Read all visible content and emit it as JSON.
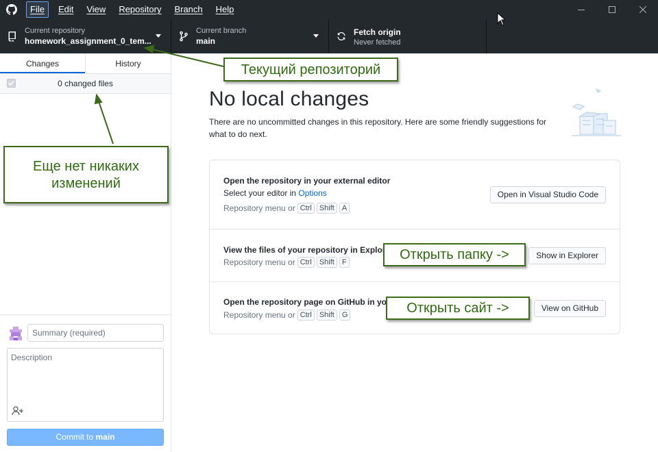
{
  "menu": {
    "items": [
      "File",
      "Edit",
      "View",
      "Repository",
      "Branch",
      "Help"
    ],
    "active_index": 0
  },
  "toolbar": {
    "repo_label": "Current repository",
    "repo_value": "homework_assignment_0_tem...",
    "branch_label": "Current branch",
    "branch_value": "main",
    "fetch_title": "Fetch origin",
    "fetch_sub": "Never fetched"
  },
  "sidebar": {
    "tabs": [
      "Changes",
      "History"
    ],
    "selected_tab": "Changes",
    "changed_files": "0 changed files"
  },
  "commit": {
    "summary_placeholder": "Summary (required)",
    "description_placeholder": "Description",
    "button_prefix": "Commit to ",
    "button_branch": "main"
  },
  "main": {
    "heading": "No local changes",
    "subtext": "There are no uncommitted changes in this repository. Here are some friendly suggestions for what to do next.",
    "suggestions": [
      {
        "title": "Open the repository in your external editor",
        "line_prefix": "Select your editor in ",
        "line_link": "Options",
        "hint": "Repository menu or",
        "keys": [
          "Ctrl",
          "Shift",
          "A"
        ],
        "button": "Open in Visual Studio Code"
      },
      {
        "title": "View the files of your repository in Explorer",
        "hint": "Repository menu or",
        "keys": [
          "Ctrl",
          "Shift",
          "F"
        ],
        "button": "Show in Explorer"
      },
      {
        "title": "Open the repository page on GitHub in your browser",
        "hint": "Repository menu or",
        "keys": [
          "Ctrl",
          "Shift",
          "G"
        ],
        "button": "View on GitHub"
      }
    ]
  },
  "annotations": {
    "current_repo": "Текущий репозиторий",
    "no_changes_line1": "Еще нет никаких",
    "no_changes_line2": "изменений",
    "open_folder": "Открыть папку ->",
    "open_site": "Открыть сайт ->"
  },
  "colors": {
    "toolbar_bg": "#24292e",
    "accent": "#0366d6",
    "commit_button": "#79b8ff",
    "annotation_border": "#3b6a1a",
    "annotation_text": "#2f6b0f"
  }
}
